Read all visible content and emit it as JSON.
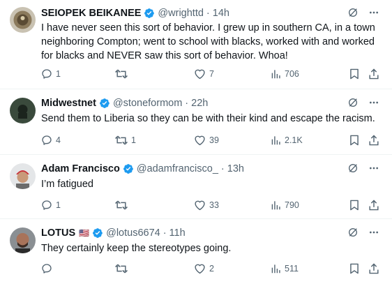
{
  "tweets": [
    {
      "name": "SEIOPEK BEIKANEE",
      "handle": "@wrighttd",
      "time": "14h",
      "text": "I have never seen this sort of behavior.  I grew up in southern CA, in a town neighboring Compton; went to school with blacks, worked with and worked for blacks and NEVER saw this sort of behavior. Whoa!",
      "replies": "1",
      "retweets": "",
      "likes": "7",
      "views": "706"
    },
    {
      "name": "Midwestnet",
      "handle": "@stoneformom",
      "time": "22h",
      "text": "Send them to Liberia so they can be with their kind and escape the racism.",
      "replies": "4",
      "retweets": "1",
      "likes": "39",
      "views": "2.1K"
    },
    {
      "name": "Adam Francisco",
      "handle": "@adamfrancisco_",
      "time": "13h",
      "text": "I’m fatigued",
      "replies": "1",
      "retweets": "",
      "likes": "33",
      "views": "790"
    },
    {
      "name": "LOTUS",
      "handle": "@lotus6674",
      "time": "11h",
      "flag": "🇺🇸",
      "text": "They certainly keep the stereotypes going.",
      "replies": "",
      "retweets": "",
      "likes": "2",
      "views": "511"
    }
  ],
  "colors": {
    "verified": "#1d9bf0",
    "secondary_text": "#536471",
    "primary_text": "#0f1419",
    "divider": "#eff3f4"
  },
  "icons": [
    "verified-badge-icon",
    "grok-icon",
    "more-icon",
    "reply-icon",
    "retweet-icon",
    "like-icon",
    "views-icon",
    "bookmark-icon",
    "share-icon"
  ]
}
